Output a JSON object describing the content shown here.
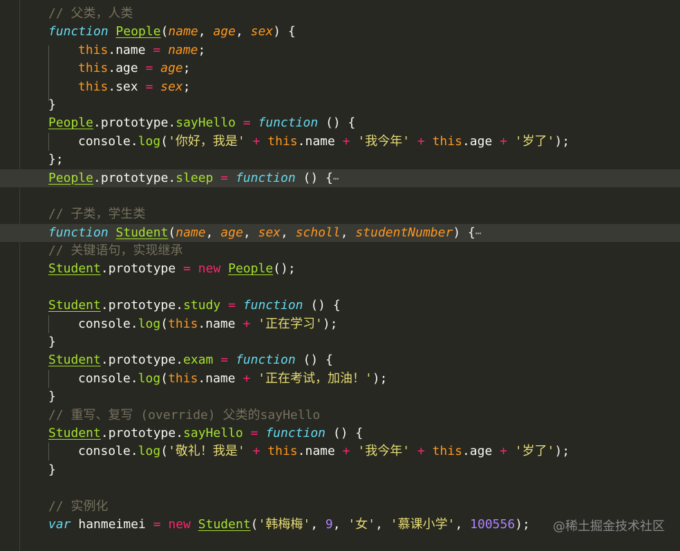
{
  "editor": {
    "comment_parent": "// 父类，人类",
    "fn_kw": "function",
    "people": "People",
    "student": "Student",
    "p_name": "name",
    "p_age": "age",
    "p_sex": "sex",
    "p_scholl": "scholl",
    "p_studentNumber": "studentNumber",
    "this_kw": "this",
    "prop_name": ".name",
    "prop_age": ".age",
    "prop_sex": ".sex",
    "prototype": ".prototype.",
    "prototype_end": ".prototype",
    "sayHello": "sayHello",
    "sleep": "sleep",
    "study": "study",
    "exam": "exam",
    "console": "console.",
    "log": "log",
    "str_hello": "'你好，我是'",
    "str_age": "'我今年'",
    "str_years": "'岁了'",
    "str_studying": "'正在学习'",
    "str_exam": "'正在考试，加油！'",
    "str_salute": "'敬礼！我是'",
    "comment_child": "// 子类，学生类",
    "comment_key": "// 关键语句，实现继承",
    "new_kw": "new",
    "comment_override": "// 重写、复写 (override) 父类的sayHello",
    "comment_instance": "// 实例化",
    "var_kw": "var",
    "hanmeimei": "hanmeimei",
    "str_name": "'韩梅梅'",
    "num_age": "9",
    "str_female": "'女'",
    "str_school": "'慕课小学'",
    "num_id": "100556",
    "fold_marker": "⋯"
  },
  "watermark": "@稀土掘金技术社区",
  "colors": {
    "background": "#272822",
    "keyword_fn": "#66d9ef",
    "keyword": "#f92672",
    "this_param": "#fd971f",
    "class_name": "#a6e22e",
    "string": "#e6db74",
    "number": "#ae81ff",
    "comment": "#75715e"
  }
}
